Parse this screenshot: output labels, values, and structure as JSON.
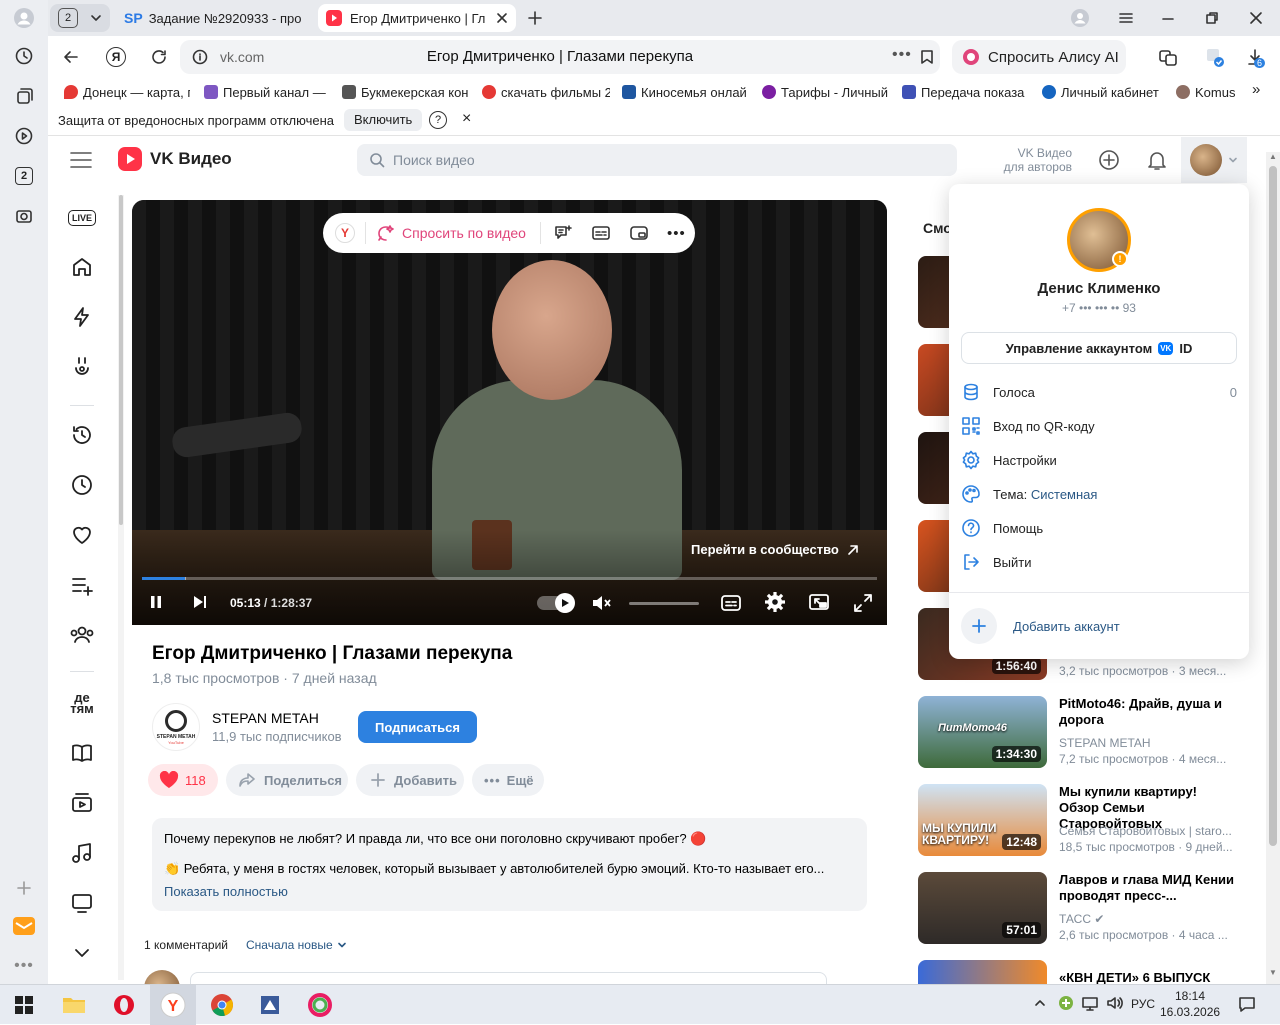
{
  "browser": {
    "tab_count": "2",
    "tabs": [
      {
        "title": "Задание №2920933 - про",
        "favicon": "SP"
      },
      {
        "title": "Егор Дмитриченко | Гл"
      }
    ],
    "url": "vk.com",
    "page_title": "Егор Дмитриченко | Глазами перекупа",
    "alice_label": "Спросить Алису AI",
    "downloads_badge": "6",
    "rail_badge": "2",
    "bookmarks": [
      {
        "label": "Донецк — карта, г",
        "color": "#e53935"
      },
      {
        "label": "Первый канал — с",
        "color": "#7e57c2"
      },
      {
        "label": "Букмекерская кон",
        "color": "#555555"
      },
      {
        "label": "скачать фильмы 2",
        "color": "#e53935"
      },
      {
        "label": "Киносемья онлай",
        "color": "#1e56a0"
      },
      {
        "label": "Тарифы - Личный",
        "color": "#7b1fa2"
      },
      {
        "label": "Передача показа",
        "color": "#3f51b5"
      },
      {
        "label": "Личный кабинет",
        "color": "#1565c0"
      },
      {
        "label": "Komus",
        "color": "#8d6e63"
      }
    ],
    "infobar": {
      "text": "Защита от вредоносных программ отключена",
      "button": "Включить",
      "help": "?",
      "close": "×"
    }
  },
  "vk": {
    "logo_text": "VK Видео",
    "search_placeholder": "Поиск видео",
    "for_authors_line1": "VK Видео",
    "for_authors_line2": "для авторов",
    "live_label": "LIVE",
    "kids_label_1": "де",
    "kids_label_2": "тям"
  },
  "player": {
    "ask_label": "Спросить по видео",
    "community_label": "Перейти в сообщество",
    "time_current": "05:13",
    "time_separator": " / ",
    "time_total": "1:28:37",
    "progress": 0.058,
    "buffer": 0.06
  },
  "video": {
    "title": "Егор Дмитриченко | Глазами перекупа",
    "views": "1,8 тыс просмотров",
    "date": "7 дней назад",
    "channel_name": "STEPAN METAH",
    "channel_logo_text": "STEPAN METAH",
    "channel_logo_sub": "YouTube",
    "subscribers": "11,9 тыс подписчиков",
    "subscribe_label": "Подписаться",
    "likes": "118",
    "share_label": "Поделиться",
    "add_label": "Добавить",
    "more_label": "Ещё",
    "description_line1": "Почему перекупов не любят? И правда ли, что все они поголовно скручивают пробег? 🔴",
    "description_line2": "👏 Ребята, у меня в гостях человек, который вызывает у автолюбителей бурю эмоций. Кто-то называет его...",
    "show_more": "Показать полностью",
    "comments_count": "1 комментарий",
    "sort_label": "Сначала новые"
  },
  "recommendations": {
    "heading": "Смо",
    "items": [
      {
        "duration": "",
        "title": "",
        "channel": "",
        "meta": ""
      },
      {
        "duration": "",
        "title": "",
        "channel": "",
        "meta": ""
      },
      {
        "duration": "",
        "title": "",
        "channel": "",
        "meta": ""
      },
      {
        "duration": "",
        "title": "",
        "channel": "",
        "meta": ""
      },
      {
        "duration": "1:56:40",
        "title": "",
        "channel": "",
        "meta": "3,2 тыс просмотров · 3 меся..."
      },
      {
        "duration": "1:34:30",
        "title": "PitMoto46: Драйв, душа и дорога",
        "channel": "STEPAN METAH",
        "meta": "7,2 тыс просмотров · 4 меся...",
        "overlay": "ПитМото46"
      },
      {
        "duration": "12:48",
        "title": "Мы купили квартиру! Обзор Семьи Старовойтовых",
        "channel": "Семья Старовойтовых | staro...",
        "meta": "18,5 тыс просмотров · 9 дней...",
        "overlay": "МЫ КУПИЛИ КВАРТИРУ!"
      },
      {
        "duration": "57:01",
        "title": "Лавров и глава МИД Кении проводят пресс-...",
        "channel": "ТАСС ✔",
        "meta": "2,6 тыс просмотров · 4 часа ..."
      },
      {
        "duration": "",
        "title": "«КВН ДЕТИ» 6 ВЫПУСК",
        "channel": "",
        "meta": ""
      }
    ]
  },
  "account_menu": {
    "name": "Денис Клименко",
    "phone": "+7 ••• ••• •• 93",
    "manage_label": "Управление аккаунтом",
    "vk_badge": "VK",
    "id_label": "ID",
    "items": [
      {
        "label": "Голоса",
        "value": "0",
        "icon": "coins-icon"
      },
      {
        "label": "Вход по QR-коду",
        "value": "",
        "icon": "qr-icon"
      },
      {
        "label": "Настройки",
        "value": "",
        "icon": "gear-icon"
      },
      {
        "label": "Тема:",
        "value": "Системная",
        "icon": "palette-icon"
      },
      {
        "label": "Помощь",
        "value": "",
        "icon": "help-icon"
      },
      {
        "label": "Выйти",
        "value": "",
        "icon": "logout-icon"
      }
    ],
    "add_account": "Добавить аккаунт"
  },
  "taskbar": {
    "lang": "РУС",
    "time": "18:14",
    "date": "16.03.2026"
  },
  "colors": {
    "accent": "#2d81e0",
    "vk_red": "#ff3347",
    "link": "#2a5885",
    "subscribe": "#2d81e0"
  }
}
